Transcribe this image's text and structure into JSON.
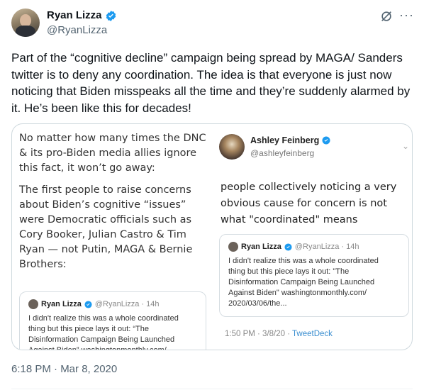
{
  "tweet": {
    "author_name": "Ryan Lizza",
    "author_handle": "@RyanLizza",
    "more_icon": "more-icon",
    "text": "Part of the “cognitive decline” campaign being spread by MAGA/ Sanders twitter is to deny any coordination. The idea is that everyone is just now noticing that Biden misspeaks all the time and they’re suddenly alarmed by it. He’s been like this for decades!",
    "timestamp": "6:18 PM · Mar 8, 2020"
  },
  "media": {
    "left_para1": "No matter how many times the DNC & its pro-Biden media allies ignore this fact, it won’t go away:",
    "left_para2": "The first people to raise concerns about Biden’s cognitive “issues” were Democratic officials such as Cory Booker, Julian Castro & Tim Ryan — not Putin, MAGA & Bernie Brothers:",
    "quote1": {
      "name": "Ryan Lizza",
      "handle_time": "@RyanLizza · 14h",
      "text": "I didn't realize this was a whole coordinated thing but this piece lays it out: “The Disinformation Campaign Being Launched Against Biden” washingtonmonthly.com/"
    },
    "ashley": {
      "name": "Ashley Feinberg",
      "handle": "@ashleyfeinberg",
      "text": "people collectively noticing a very obvious cause for concern is not what \"coordinated\" means"
    },
    "quote2": {
      "name": "Ryan Lizza",
      "handle_time": "@RyanLizza · 14h",
      "text": "I didn't realize this was a whole coordinated thing but this piece lays it out: \"The Disinformation Campaign Being Launched Against Biden\" washingtonmonthly.com/ 2020/03/06/the..."
    },
    "meta_time": "1:50 PM · 3/8/20 · ",
    "meta_source": "TweetDeck"
  },
  "colors": {
    "verified": "#1d9bf0",
    "secondary_text": "#536471",
    "link": "#3a8ed0"
  }
}
